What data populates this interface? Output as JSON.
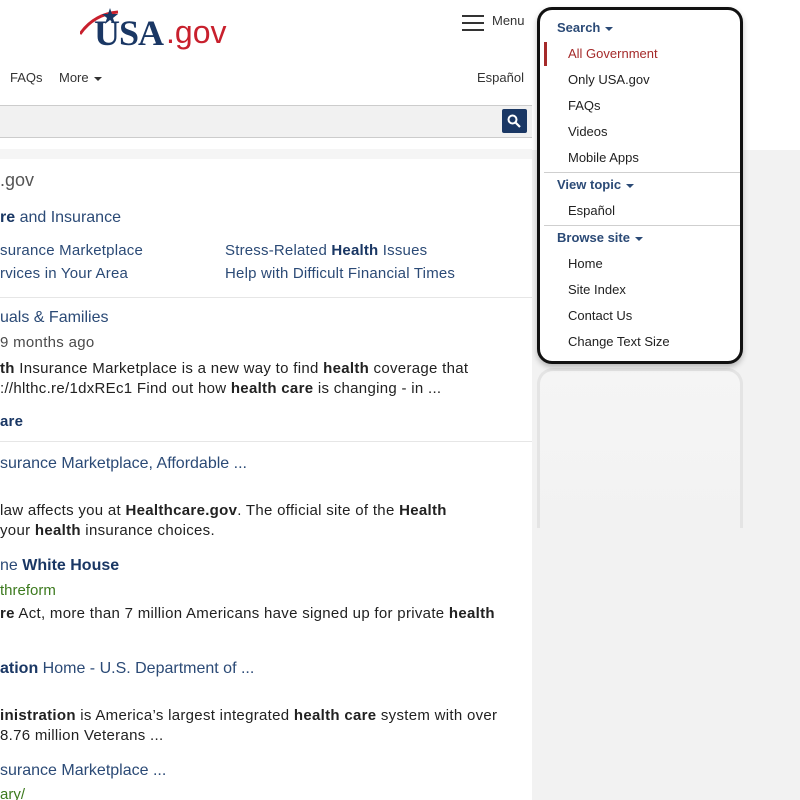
{
  "header": {
    "logo_usa": "USA",
    "logo_gov": ".gov",
    "menu_label": "Menu",
    "nav": {
      "faqs": "FAQs",
      "more": "More",
      "espanol": "Español"
    }
  },
  "results": {
    "site_name": ".gov",
    "r1": {
      "title_bold": "re",
      "title_rest": " and Insurance",
      "links": [
        {
          "pre": "",
          "bold": "",
          "post": "surance Marketplace"
        },
        {
          "pre": "rvices in Your Area",
          "bold": "",
          "post": ""
        },
        {
          "pre": "Stress-Related ",
          "bold": "Health",
          "post": " Issues"
        },
        {
          "pre": "Help with Difficult Financial Times",
          "bold": "",
          "post": ""
        }
      ]
    },
    "r2": {
      "title": "uals & Families",
      "date": "9 months ago",
      "snip1": {
        "bold1": "th",
        "mid": " Insurance Marketplace is a new way to find ",
        "bold2": "health",
        "post": " coverage that"
      },
      "snip2": {
        "pre": "://hlthc.re/1dxREc1 Find out how ",
        "bold1": "health care",
        "post": " is changing - in ..."
      },
      "more": "are"
    },
    "r3": {
      "title": "surance Marketplace, Affordable ...",
      "snip1": {
        "pre": "law affects you at ",
        "bold1": "Healthcare.gov",
        "mid": ". The official site of the ",
        "bold2": "Health"
      },
      "snip2": {
        "pre": "your ",
        "bold1": "health",
        "post": " insurance choices."
      }
    },
    "r4": {
      "title_pre": "ne ",
      "title_bold": "White House",
      "url": "threform",
      "snip1": {
        "bold1": "re",
        "mid": " Act, more than 7 million Americans have signed up for private ",
        "bold2": "health"
      }
    },
    "r5": {
      "title_bold": "ation",
      "title_rest": " Home - U.S. Department of ...",
      "snip1": {
        "bold1": "inistration",
        "mid": " is America’s largest integrated ",
        "bold2": "health care",
        "post": " system with over"
      },
      "snip2": "8.76 million Veterans ..."
    },
    "r6": {
      "title": "surance Marketplace ...",
      "url": "ary/"
    }
  },
  "menu_panel": {
    "search_head": "Search",
    "search_items": [
      "All Government",
      "Only USA.gov",
      "FAQs",
      "Videos",
      "Mobile Apps"
    ],
    "topic_head": "View topic",
    "topic_items": [
      "Español"
    ],
    "browse_head": "Browse site",
    "browse_items": [
      "Home",
      "Site Index",
      "Contact Us",
      "Change Text Size"
    ]
  },
  "colors": {
    "brand_navy": "#1a3764",
    "brand_red": "#c8202d",
    "active": "#a52a2a",
    "url_green": "#3c7a1e"
  },
  "icons": {
    "search_button": "magnifier-icon",
    "menu": "hamburger-icon",
    "logo_mark": "star-swoosh-icon"
  }
}
